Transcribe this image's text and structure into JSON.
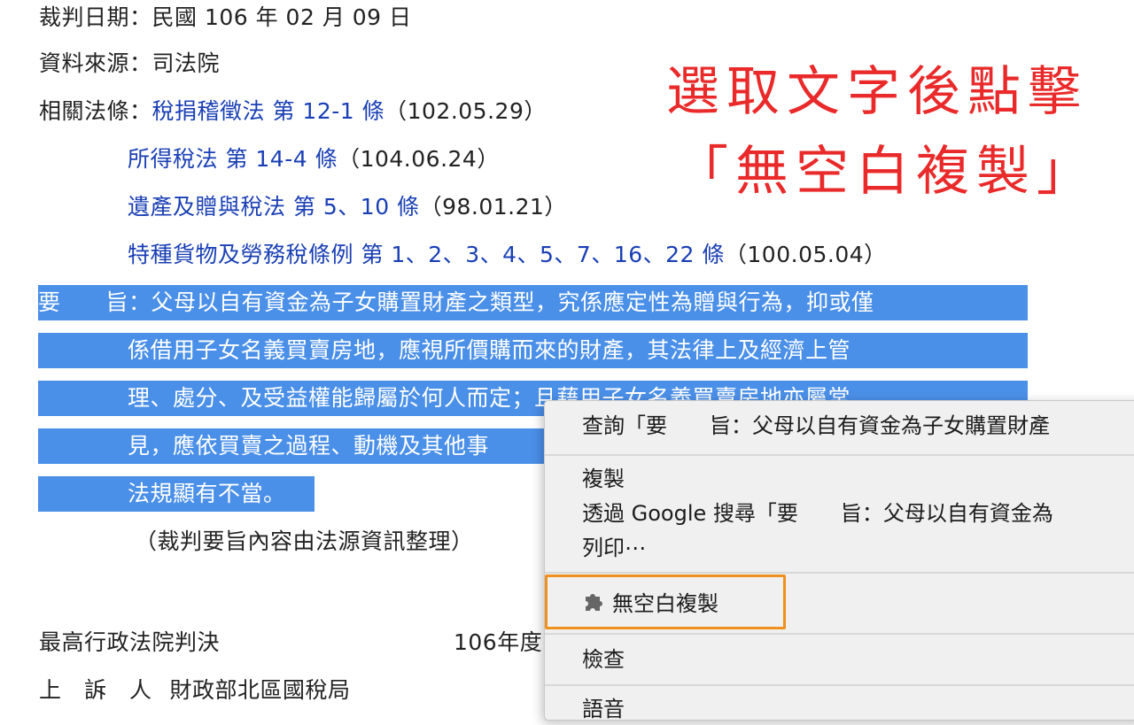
{
  "document": {
    "date_line": "裁判日期：民國 106 年 02 月 09 日",
    "source_line": "資料來源：司法院",
    "laws_label": "相關法條：",
    "laws": [
      {
        "name": "稅捐稽徵法 第 12-1 條",
        "date": "（102.05.29）"
      },
      {
        "name": "所得稅法 第 14-4 條",
        "date": "（104.06.24）"
      },
      {
        "name": "遺產及贈與稅法 第 5、10 條",
        "date": "（98.01.21）"
      },
      {
        "name": "特種貨物及勞務稅條例 第 1、2、3、4、5、7、16、22 條",
        "date": "（100.05.04）"
      }
    ],
    "summary_lines": [
      "要　　旨：父母以自有資金為子女購置財產之類型，究係應定性為贈與行為，抑或僅",
      "係借用子女名義買賣房地，應視所價購而來的財產，其法律上及經濟上管",
      "理、處分、及受益權能歸屬於何人而定；且藉用子女名義買賣房地亦屬常",
      "見，應依買賣之過程、動機及其他事",
      "法規顯有不當。"
    ],
    "note": "（裁判要旨內容由法源資訊整理）",
    "court_line": "最高行政法院判決",
    "year_text": "106年度",
    "appellant_label": "上　訴　人",
    "appellant_value": "財政部北區國稅局"
  },
  "annotation": {
    "line1": "選取文字後點擊",
    "line2": "「無空白複製」",
    "color": "#ea2a2a"
  },
  "context_menu": {
    "items": {
      "lookup": "查詢「要　　旨：父母以自有資金為子女購置財產",
      "copy": "複製",
      "google": "透過 Google 搜尋「要　　旨：父母以自有資金為",
      "print": "列印⋯",
      "extension": "無空白複製",
      "inspect": "檢查",
      "partial": "語音"
    },
    "highlight_color": "#f0901e"
  },
  "colors": {
    "link": "#1a3fb5",
    "selection": "#4a8fe8"
  }
}
